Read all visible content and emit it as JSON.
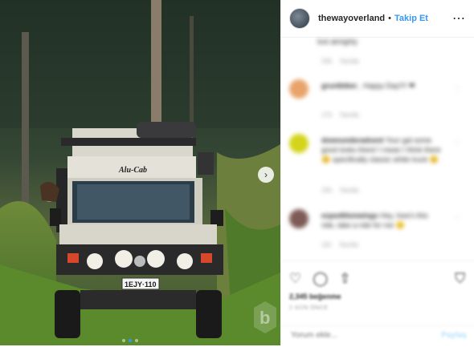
{
  "post": {
    "image": {
      "vehicle_brand_text": "Alu-Cab",
      "license_plate": "1EJY·110",
      "watermark_letter": "b",
      "carousel_dots": 3,
      "active_dot": 2
    }
  },
  "header": {
    "username": "thewayoverland",
    "separator": "•",
    "follow_label": "Takip Et",
    "more_icon": "⋯"
  },
  "comments": {
    "top_fragment": "lost almighty",
    "top_meta": {
      "time": "24h",
      "reply": "Yanıtla"
    },
    "items": [
      {
        "name": "gruntbiker_",
        "text": "Happy Day!!!! ❤",
        "avatar_color": "#e8a36a",
        "meta_time": "17h",
        "meta_reply": "Yanıtla"
      },
      {
        "name": "downunderadvent",
        "text": "Your gal some good looks there! I mean I think there 😊 specifically classic white truck 😊",
        "avatar_color": "#d4d41a",
        "meta_time": "15h",
        "meta_reply": "Yanıtla"
      },
      {
        "name": "expeditionwings",
        "text": "Hey, how's this ride, take a ride for me 🙂",
        "avatar_color": "#7d5a55",
        "meta_time": "11h",
        "meta_reply": "Yanıtla"
      }
    ]
  },
  "actions": {
    "like_icon": "♡",
    "comment_icon": "◯",
    "share_icon": "⇧",
    "save_icon": "⛉",
    "likes_text": "2,345 beğenme",
    "time_text": "2 GÜN ÖNCE"
  },
  "add_comment": {
    "placeholder": "Yorum ekle...",
    "post_label": "Paylaş"
  }
}
